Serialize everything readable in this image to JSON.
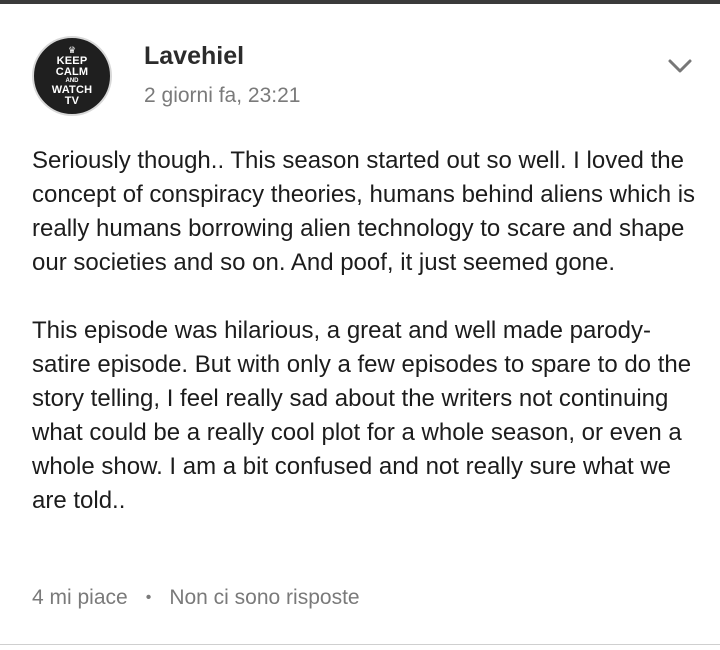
{
  "comment": {
    "avatar": {
      "crown": "♛",
      "line1": "KEEP",
      "line2": "CALM",
      "line3": "AND",
      "line4": "WATCH",
      "line5": "TV"
    },
    "author": "Lavehiel",
    "timestamp": "2 giorni fa, 23:21",
    "menu_icon": "chevron-down-icon",
    "paragraphs": [
      "Seriously though.. This season started out so well. I loved the concept of conspiracy theories, humans behind aliens which is really humans borrowing alien technology to scare and shape our societies and so on. And poof, it just seemed gone.",
      "This episode was hilarious, a great and well made parody-satire episode. But with only a few episodes to spare to do the story telling, I feel really sad about the writers not continuing what could be a really cool plot for a whole season, or even a whole show. I am a bit confused and not really sure what we are told.."
    ],
    "likes": "4 mi piace",
    "separator": "•",
    "replies": "Non ci sono risposte"
  }
}
